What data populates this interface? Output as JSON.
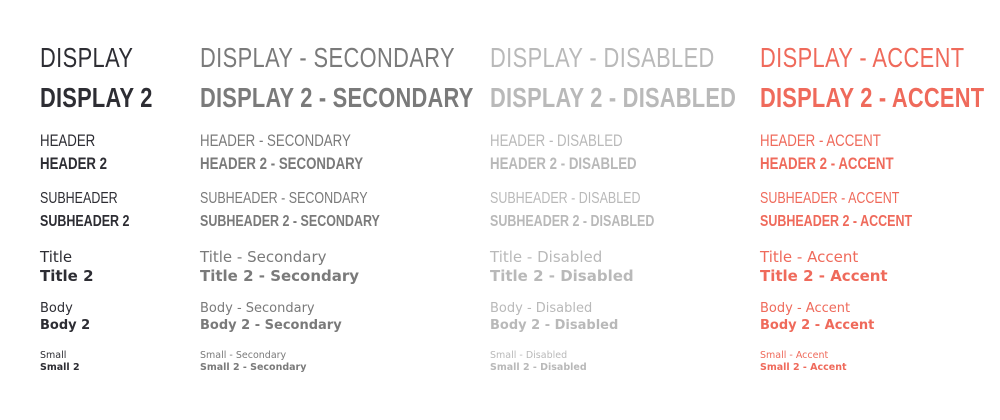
{
  "columns": [
    {
      "id": "primary",
      "color": "#2d2d33",
      "display": "DISPLAY",
      "display2": "DISPLAY 2",
      "header": "HEADER",
      "header2": "HEADER 2",
      "subheader": "SUBHEADER",
      "subheader2": "SUBHEADER 2",
      "title": "Title",
      "title2": "Title 2",
      "body": "Body",
      "body2": "Body 2",
      "small": "Small",
      "small2": "Small 2"
    },
    {
      "id": "secondary",
      "color": "#7a7a7a",
      "display": "DISPLAY - SECONDARY",
      "display2": "DISPLAY 2 - SECONDARY",
      "header": "HEADER - SECONDARY",
      "header2": "HEADER 2 - SECONDARY",
      "subheader": "SUBHEADER - SECONDARY",
      "subheader2": "SUBHEADER 2 - SECONDARY",
      "title": "Title - Secondary",
      "title2": "Title 2 - Secondary",
      "body": "Body - Secondary",
      "body2": "Body 2 - Secondary",
      "small": "Small - Secondary",
      "small2": "Small 2 - Secondary"
    },
    {
      "id": "disabled",
      "color": "#b9b9b9",
      "display": "DISPLAY - DISABLED",
      "display2": "DISPLAY 2 - DISABLED",
      "header": "HEADER - DISABLED",
      "header2": "HEADER 2 - DISABLED",
      "subheader": "SUBHEADER - DISABLED",
      "subheader2": "SUBHEADER 2 - DISABLED",
      "title": "Title - Disabled",
      "title2": "Title 2 - Disabled",
      "body": "Body - Disabled",
      "body2": "Body 2 - Disabled",
      "small": "Small - Disabled",
      "small2": "Small 2 - Disabled"
    },
    {
      "id": "accent",
      "color": "#ef6a5b",
      "display": "DISPLAY - ACCENT",
      "display2": "DISPLAY 2 - ACCENT",
      "header": "HEADER - ACCENT",
      "header2": "HEADER 2 - ACCENT",
      "subheader": "SUBHEADER - ACCENT",
      "subheader2": "SUBHEADER 2 - ACCENT",
      "title": "Title - Accent",
      "title2": "Title 2 - Accent",
      "body": "Body - Accent",
      "body2": "Body 2 - Accent",
      "small": "Small - Accent",
      "small2": "Small 2 - Accent"
    }
  ]
}
